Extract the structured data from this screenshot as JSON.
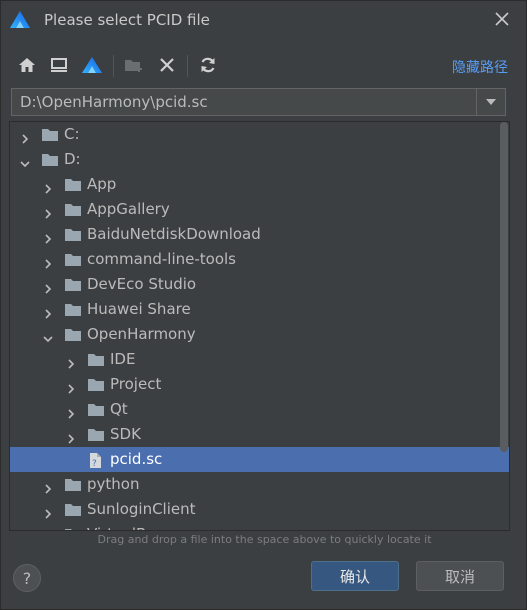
{
  "dialog": {
    "title": "Please select PCID file",
    "hide_path_label": "隐藏路径",
    "path_value": "D:\\OpenHarmony\\pcid.sc",
    "hint": "Drag and drop a file into the space above to quickly locate it",
    "help_label": "?",
    "ok_label": "确认",
    "cancel_label": "取消"
  },
  "toolbar": {
    "icons": [
      "home-icon",
      "desktop-icon",
      "project-icon",
      "new-folder-icon",
      "delete-icon",
      "refresh-icon"
    ]
  },
  "tree": [
    {
      "label": "C:",
      "depth": 0,
      "expanded": false,
      "type": "drive"
    },
    {
      "label": "D:",
      "depth": 0,
      "expanded": true,
      "type": "drive"
    },
    {
      "label": "App",
      "depth": 1,
      "expanded": false,
      "type": "folder"
    },
    {
      "label": "AppGallery",
      "depth": 1,
      "expanded": false,
      "type": "folder"
    },
    {
      "label": "BaiduNetdiskDownload",
      "depth": 1,
      "expanded": false,
      "type": "folder"
    },
    {
      "label": "command-line-tools",
      "depth": 1,
      "expanded": false,
      "type": "folder"
    },
    {
      "label": "DevEco Studio",
      "depth": 1,
      "expanded": false,
      "type": "folder"
    },
    {
      "label": "Huawei Share",
      "depth": 1,
      "expanded": false,
      "type": "folder"
    },
    {
      "label": "OpenHarmony",
      "depth": 1,
      "expanded": true,
      "type": "folder"
    },
    {
      "label": "IDE",
      "depth": 2,
      "expanded": false,
      "type": "folder"
    },
    {
      "label": "Project",
      "depth": 2,
      "expanded": false,
      "type": "folder"
    },
    {
      "label": "Qt",
      "depth": 2,
      "expanded": false,
      "type": "folder"
    },
    {
      "label": "SDK",
      "depth": 2,
      "expanded": false,
      "type": "folder"
    },
    {
      "label": "pcid.sc",
      "depth": 2,
      "expanded": null,
      "type": "file",
      "selected": true
    },
    {
      "label": "python",
      "depth": 1,
      "expanded": false,
      "type": "folder"
    },
    {
      "label": "SunloginClient",
      "depth": 1,
      "expanded": false,
      "type": "folder"
    },
    {
      "label": "VirtualBox",
      "depth": 1,
      "expanded": false,
      "type": "folder"
    }
  ],
  "colors": {
    "background": "#3c3f41",
    "selection": "#4b6eaf",
    "accent_link": "#589df6",
    "primary_button": "#365880",
    "folder": "#9aa7b0"
  }
}
